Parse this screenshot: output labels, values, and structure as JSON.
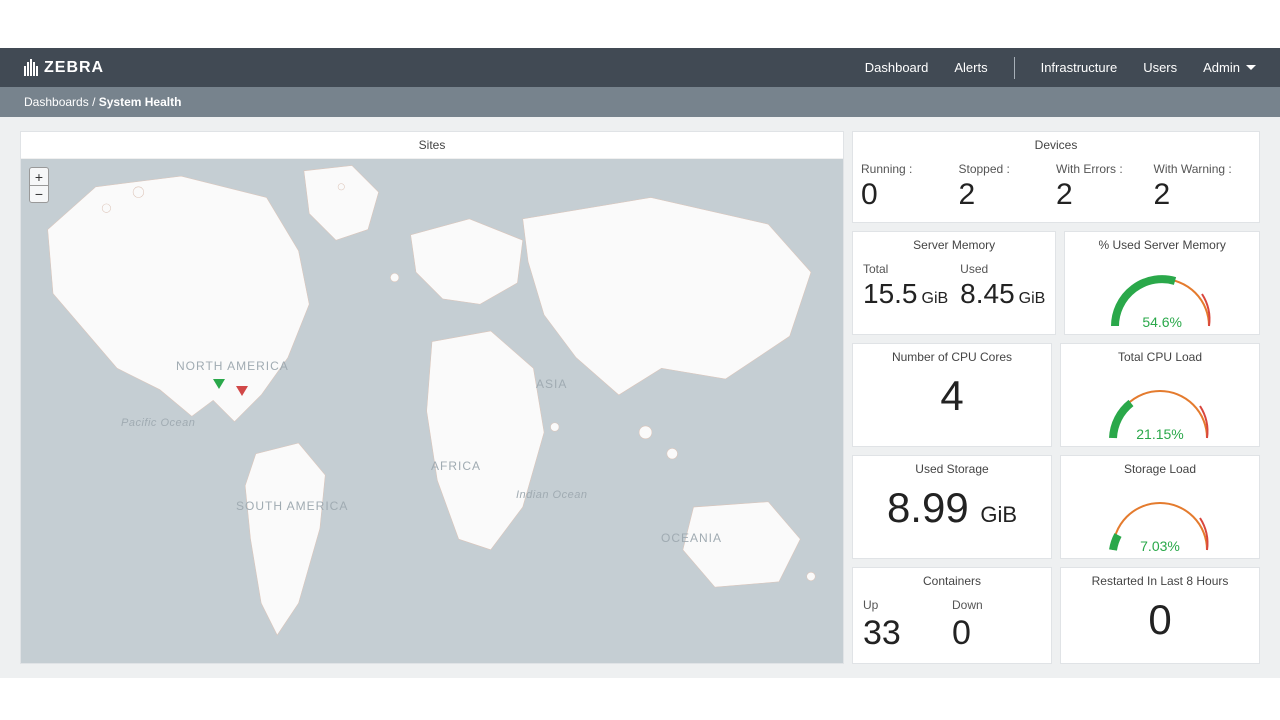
{
  "brand": "ZEBRA",
  "nav": {
    "dashboard": "Dashboard",
    "alerts": "Alerts",
    "infrastructure": "Infrastructure",
    "users": "Users",
    "admin": "Admin"
  },
  "breadcrumb": {
    "parent": "Dashboards",
    "current": "System Health"
  },
  "sites": {
    "title": "Sites"
  },
  "map_labels": {
    "north_america": "NORTH AMERICA",
    "south_america": "SOUTH AMERICA",
    "africa": "AFRICA",
    "asia": "ASIA",
    "oceania": "OCEANIA",
    "pacific": "Pacific Ocean",
    "indian": "Indian Ocean"
  },
  "devices": {
    "title": "Devices",
    "running_label": "Running :",
    "running": "0",
    "stopped_label": "Stopped :",
    "stopped": "2",
    "errors_label": "With Errors :",
    "errors": "2",
    "warning_label": "With Warning :",
    "warning": "2"
  },
  "server_memory": {
    "title": "Server Memory",
    "total_label": "Total",
    "total": "15.5",
    "used_label": "Used",
    "used": "8.45",
    "unit": "GiB"
  },
  "pct_memory": {
    "title": "% Used Server Memory",
    "value": "54.6%"
  },
  "cpu_cores": {
    "title": "Number of CPU Cores",
    "value": "4"
  },
  "cpu_load": {
    "title": "Total CPU Load",
    "value": "21.15%"
  },
  "used_storage": {
    "title": "Used Storage",
    "value": "8.99",
    "unit": "GiB"
  },
  "storage_load": {
    "title": "Storage Load",
    "value": "7.03%"
  },
  "containers": {
    "title": "Containers",
    "up_label": "Up",
    "up": "33",
    "down_label": "Down",
    "down": "0"
  },
  "restarted": {
    "title": "Restarted In Last 8 Hours",
    "value": "0"
  },
  "chart_data": [
    {
      "type": "bar",
      "title": "Devices",
      "categories": [
        "Running",
        "Stopped",
        "With Errors",
        "With Warning"
      ],
      "values": [
        0,
        2,
        2,
        2
      ]
    },
    {
      "type": "gauge",
      "title": "% Used Server Memory",
      "value": 54.6,
      "min": 0,
      "max": 100,
      "unit": "%"
    },
    {
      "type": "gauge",
      "title": "Total CPU Load",
      "value": 21.15,
      "min": 0,
      "max": 100,
      "unit": "%"
    },
    {
      "type": "gauge",
      "title": "Storage Load",
      "value": 7.03,
      "min": 0,
      "max": 100,
      "unit": "%"
    }
  ]
}
